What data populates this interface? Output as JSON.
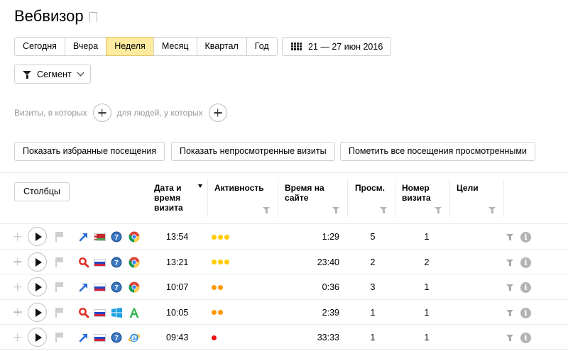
{
  "page": {
    "title": "Вебвизор"
  },
  "periods": [
    {
      "label": "Сегодня",
      "active": false
    },
    {
      "label": "Вчера",
      "active": false
    },
    {
      "label": "Неделя",
      "active": true
    },
    {
      "label": "Месяц",
      "active": false
    },
    {
      "label": "Квартал",
      "active": false
    },
    {
      "label": "Год",
      "active": false
    }
  ],
  "date_range": "21 — 27 июн 2016",
  "segment_label": "Сегмент",
  "filter": {
    "visits_label": "Визиты, в которых",
    "people_label": "для людей, у которых"
  },
  "actions": {
    "show_favorites": "Показать избранные посещения",
    "show_unwatched": "Показать непросмотренные визиты",
    "mark_all_watched": "Пометить все посещения просмотренными"
  },
  "columns_button": "Столбцы",
  "table": {
    "headers": {
      "date": "Дата и время визита",
      "activity": "Активность",
      "time_on_site": "Время на сайте",
      "views": "Просм.",
      "visit_number": "Номер визита",
      "goals": "Цели"
    },
    "rows": [
      {
        "source": "link",
        "country": "by",
        "os": "win7",
        "browser": "chrome",
        "time": "13:54",
        "activity": 3,
        "activity_color": "#ffcc00",
        "duration": "1:29",
        "views": "5",
        "visit_number": "1"
      },
      {
        "source": "search",
        "country": "ru",
        "os": "win7",
        "browser": "chrome",
        "time": "13:21",
        "activity": 3,
        "activity_color": "#ffcc00",
        "duration": "23:40",
        "views": "2",
        "visit_number": "2"
      },
      {
        "source": "link",
        "country": "ru",
        "os": "win7",
        "browser": "chrome",
        "time": "10:07",
        "activity": 2,
        "activity_color": "#ff9900",
        "duration": "0:36",
        "views": "3",
        "visit_number": "1"
      },
      {
        "source": "search",
        "country": "ru",
        "os": "win8",
        "browser": "amigo",
        "time": "10:05",
        "activity": 2,
        "activity_color": "#ff9900",
        "duration": "2:39",
        "views": "1",
        "visit_number": "1"
      },
      {
        "source": "link",
        "country": "ru",
        "os": "win7",
        "browser": "ie",
        "time": "09:43",
        "activity": 1,
        "activity_color": "#ee1111",
        "duration": "33:33",
        "views": "1",
        "visit_number": "1"
      }
    ]
  },
  "icons": {
    "bookmark": "bookmark-icon",
    "calendar": "calendar-icon",
    "segment": "funnel-icon",
    "add": "plus-icon",
    "play": "play-icon",
    "flag": "flag-icon",
    "filter": "funnel-icon",
    "info": "info-icon"
  },
  "colors": {
    "active_period_bg": "#ffeba0",
    "active_period_border": "#dfc468"
  }
}
